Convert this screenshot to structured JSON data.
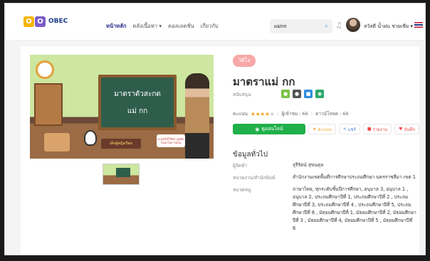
{
  "brand": {
    "letters": [
      "O",
      "O"
    ],
    "name": "OBEC",
    "colors": [
      "#f7b500",
      "#7a5cc8"
    ]
  },
  "nav": {
    "items": [
      "หน้าหลัก",
      "คลังเนื้อหา ▾",
      "คอลเลคชั่น",
      "เกี่ยวกับ"
    ]
  },
  "search": {
    "value": "แม่กก"
  },
  "user": {
    "name": "สวัสดี น้ำฝน ช่วยเซีย ▾"
  },
  "media": {
    "board_line1": "มาตราตัวสะกด",
    "board_line2": "แม่ กก",
    "banner": "เด็กผู้หญิงเรียน",
    "callout": "บางครั้งก็ใช้คำ ดูคลิป ในนะในการสอน"
  },
  "content": {
    "tag": "วิดีโอ",
    "title": "มาตราแม่ กก",
    "support_label": "สนับสนุน",
    "rating_label": "คะแนน",
    "rating": 4,
    "views": "ผู้เข้าชม : 66",
    "downloads": "ดาวน์โหลด : 66",
    "watch_label": "ดูออนไลน์",
    "rate_label": "คะแนน",
    "share_label": "แชร์",
    "report_label": "รายงาน",
    "save_label": "บันทึก",
    "section_title": "ข้อมูลทั่วไป",
    "info": [
      {
        "label": "ผู้จัดทำ",
        "value": "จุรีรัตน์ สุขนคุล"
      },
      {
        "label": "หน่วยงาน/สำนักพิมพ์",
        "value": "สำนักงานเขตพื้นที่การศึกษาประถมศึกษา นครราชสีมา เขต 1"
      },
      {
        "label": "หมวดหมู่",
        "value": "ภาษาไทย, ทุกระดับชั้นปีการศึกษา, อนุบาล 3, อนุบาล 1 , อนุบาล 2, ประถมศึกษาปีที่ 1, ประถมศึกษาปีที่ 2 , ประถมศึกษาปีที่ 3, ประถมศึกษาปีที่ 4 , ประถมศึกษาปีที่ 5, ประถมศึกษาปีที่ 6 , มัธยมศึกษาปีที่ 1, มัธยมศึกษาปีที่ 2, มัธยมศึกษาปีที่ 3 , มัธยมศึกษาปีที่ 4, มัธยมศึกษาปีที่ 5 , มัธยมศึกษาปีที่ 6"
      }
    ]
  },
  "os_icons": [
    {
      "name": "android-icon",
      "color": "#7cc243",
      "glyph": "●"
    },
    {
      "name": "apple-icon",
      "color": "#555555",
      "glyph": "●"
    },
    {
      "name": "windows-icon",
      "color": "#2f8fde",
      "glyph": "■"
    },
    {
      "name": "chrome-icon",
      "color": "#2aa86a",
      "glyph": "◉"
    }
  ]
}
